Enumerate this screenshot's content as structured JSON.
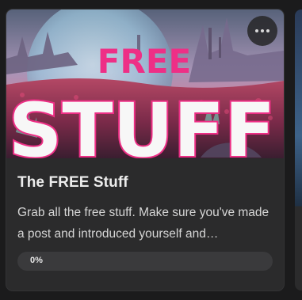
{
  "course_card": {
    "title": "The FREE Stuff",
    "description": "Grab all the free stuff. Make sure you've made a post and introduced yourself and…",
    "cover": {
      "line1": "FREE",
      "line2": "STUFF"
    },
    "menu_icon": "more-horizontal-icon",
    "progress": {
      "label": "0%",
      "value": 0
    }
  },
  "colors": {
    "card_background": "#2b2b2c",
    "page_background": "#1b1b1c",
    "title_text": "#ededed",
    "body_text": "#d6d6d6",
    "cover_pink": "#ee2f86",
    "cover_white": "#f7f7f7",
    "progress_track": "#3a3a3c"
  }
}
